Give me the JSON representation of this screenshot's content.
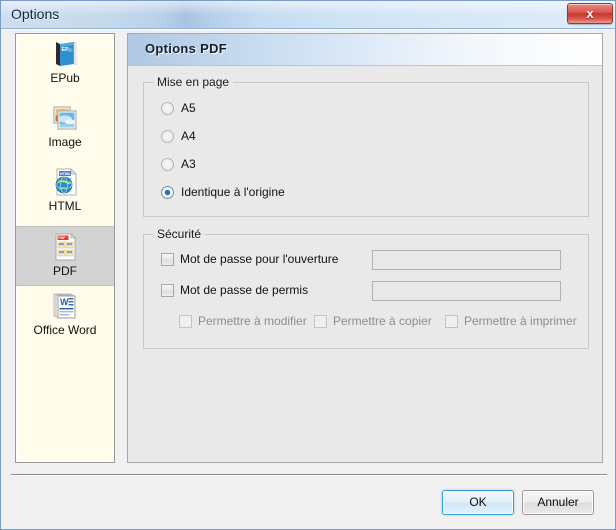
{
  "window": {
    "title": "Options",
    "close_label": "x"
  },
  "sidebar": {
    "items": [
      {
        "label": "EPub",
        "icon": "epub-book-icon",
        "selected": false
      },
      {
        "label": "Image",
        "icon": "image-photos-icon",
        "selected": false
      },
      {
        "label": "HTML",
        "icon": "html-globe-icon",
        "selected": false
      },
      {
        "label": "PDF",
        "icon": "pdf-document-icon",
        "selected": true
      },
      {
        "label": "Office Word",
        "icon": "word-document-icon",
        "selected": false
      }
    ]
  },
  "panel": {
    "title": "Options PDF",
    "layout_group": {
      "title": "Mise en page",
      "options": [
        {
          "label": "A5",
          "checked": false
        },
        {
          "label": "A4",
          "checked": false
        },
        {
          "label": "A3",
          "checked": false
        },
        {
          "label": "Identique à l'origine",
          "checked": true
        }
      ]
    },
    "security_group": {
      "title": "Sécurité",
      "open_password": {
        "label": "Mot de passe pour l'ouverture",
        "checked": false,
        "value": "",
        "placeholder": ""
      },
      "permission_password": {
        "label": "Mot de passe de permis",
        "checked": false,
        "value": "",
        "placeholder": ""
      },
      "permissions": [
        {
          "label": "Permettre à modifier",
          "checked": false,
          "disabled": true
        },
        {
          "label": "Permettre à copier",
          "checked": false,
          "disabled": true
        },
        {
          "label": "Permettre à imprimer",
          "checked": false,
          "disabled": true
        }
      ]
    }
  },
  "footer": {
    "ok_label": "OK",
    "cancel_label": "Annuler"
  },
  "colors": {
    "title_bar_start": "#cfdff0",
    "title_bar_end": "#dfedf9",
    "close_button_red": "#c6352b",
    "panel_header_blue": "#afc8e3",
    "radio_dot_blue": "#1f6fb2",
    "ok_focus_border": "#3c9fd6",
    "sidebar_background": "#fffceb",
    "sidebar_selected": "#d3d3d3",
    "dialog_background": "#f0f0f0"
  }
}
